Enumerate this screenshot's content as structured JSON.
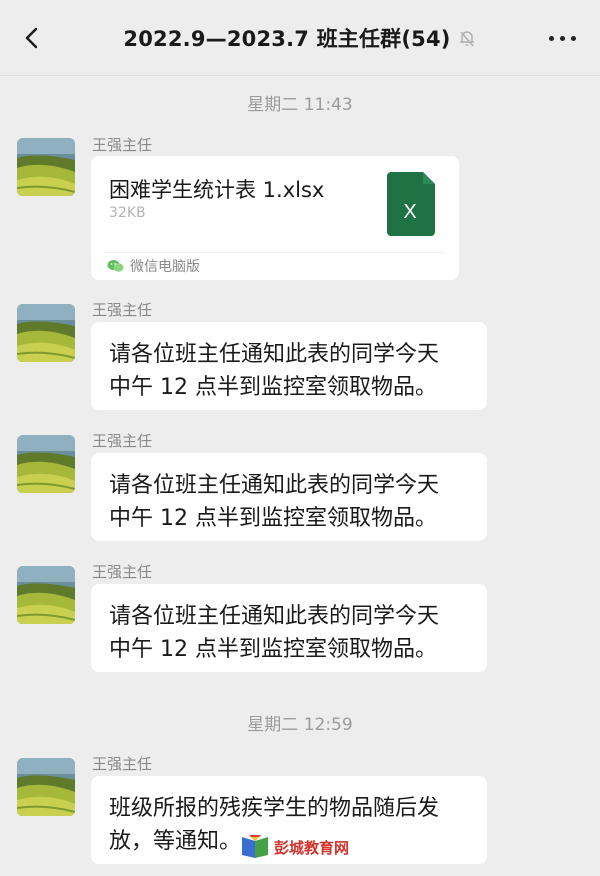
{
  "header": {
    "title": "2022.9—2023.7 班主任群(54)",
    "icons": {
      "back": "chevron-left-icon",
      "mute": "bell-muted-icon",
      "more": "more-dots-icon"
    }
  },
  "timestamps": [
    "星期二 11:43",
    "星期二 12:59"
  ],
  "messages": [
    {
      "sender": "王强主任",
      "type": "file",
      "file": {
        "name": "困难学生统计表 1.xlsx",
        "size": "32KB",
        "source": "微信电脑版",
        "icon": "excel-file-icon"
      }
    },
    {
      "sender": "王强主任",
      "type": "text",
      "lines": [
        "请各位班主任通知此表的同学今天",
        "中午 12 点半到监控室领取物品。"
      ]
    },
    {
      "sender": "王强主任",
      "type": "text",
      "lines": [
        "请各位班主任通知此表的同学今天",
        "中午 12 点半到监控室领取物品。"
      ]
    },
    {
      "sender": "王强主任",
      "type": "text",
      "lines": [
        "请各位班主任通知此表的同学今天",
        "中午 12 点半到监控室领取物品。"
      ]
    },
    {
      "sender": "王强主任",
      "type": "text",
      "lines": [
        "班级所报的残疾学生的物品随后发",
        "放，等通知。"
      ]
    }
  ],
  "watermark": {
    "text": "彭城教育网",
    "icon": "book-logo-icon"
  },
  "colors": {
    "background": "#ededed",
    "bubble": "#ffffff",
    "excel_green": "#1f7244",
    "watermark_red": "#d0342c"
  }
}
